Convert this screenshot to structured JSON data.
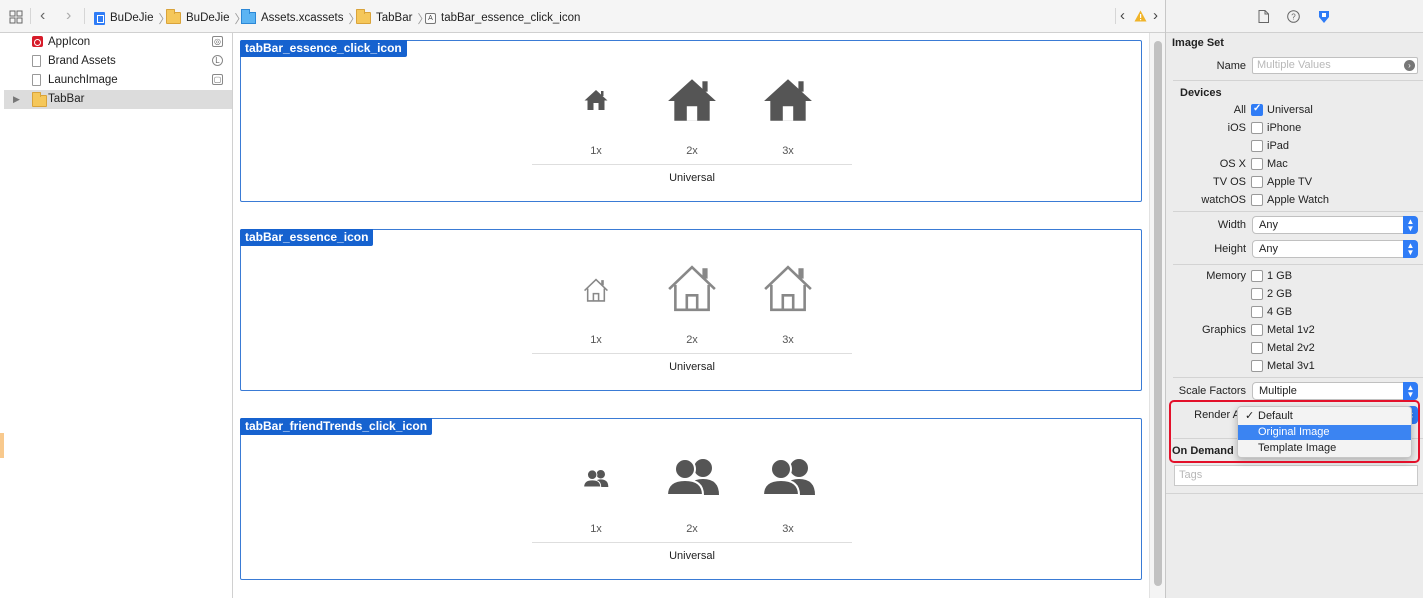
{
  "jumpbar": {
    "crumbs": [
      "BuDeJie",
      "BuDeJie",
      "Assets.xcassets",
      "TabBar",
      "tabBar_essence_click_icon"
    ]
  },
  "navigator": {
    "items": [
      {
        "label": "AppIcon",
        "icon": "app-icon"
      },
      {
        "label": "Brand Assets",
        "icon": "brand-assets-icon"
      },
      {
        "label": "LaunchImage",
        "icon": "launch-image-icon"
      },
      {
        "label": "TabBar",
        "icon": "folder-icon"
      }
    ]
  },
  "canvas": {
    "sets": [
      {
        "title": "tabBar_essence_click_icon",
        "icon": "house-filled",
        "slots": [
          "1x",
          "2x",
          "3x"
        ],
        "idiom": "Universal"
      },
      {
        "title": "tabBar_essence_icon",
        "icon": "house-outline",
        "slots": [
          "1x",
          "2x",
          "3x"
        ],
        "idiom": "Universal"
      },
      {
        "title": "tabBar_friendTrends_click_icon",
        "icon": "people-filled",
        "slots": [
          "1x",
          "2x",
          "3x"
        ],
        "idiom": "Universal"
      }
    ]
  },
  "inspector": {
    "image_set_title": "Image Set",
    "name_label": "Name",
    "name_placeholder": "Multiple Values",
    "devices_title": "Devices",
    "device_rows": [
      {
        "label": "All",
        "option": "Universal",
        "checked": true
      },
      {
        "label": "iOS",
        "option": "iPhone",
        "checked": false
      },
      {
        "label": "",
        "option": "iPad",
        "checked": false
      },
      {
        "label": "OS X",
        "option": "Mac",
        "checked": false
      },
      {
        "label": "TV OS",
        "option": "Apple TV",
        "checked": false
      },
      {
        "label": "watchOS",
        "option": "Apple Watch",
        "checked": false
      }
    ],
    "width_label": "Width",
    "width_value": "Any",
    "height_label": "Height",
    "height_value": "Any",
    "memory_label": "Memory",
    "memory_options": [
      "1 GB",
      "2 GB",
      "4 GB"
    ],
    "graphics_label": "Graphics",
    "graphics_options": [
      "Metal 1v2",
      "Metal 2v2",
      "Metal 3v1"
    ],
    "scale_label": "Scale Factors",
    "scale_value": "Multiple",
    "render_label": "Render A",
    "on_demand_label": "On Demand R",
    "tags_placeholder": "Tags",
    "render_menu": {
      "items": [
        "Default",
        "Original Image",
        "Template Image"
      ],
      "checked_index": 0,
      "highlighted_index": 1
    }
  },
  "colors": {
    "accent": "#2f7cf6",
    "set_title_bg": "#1662cf",
    "annotation_red": "#e3102a"
  }
}
